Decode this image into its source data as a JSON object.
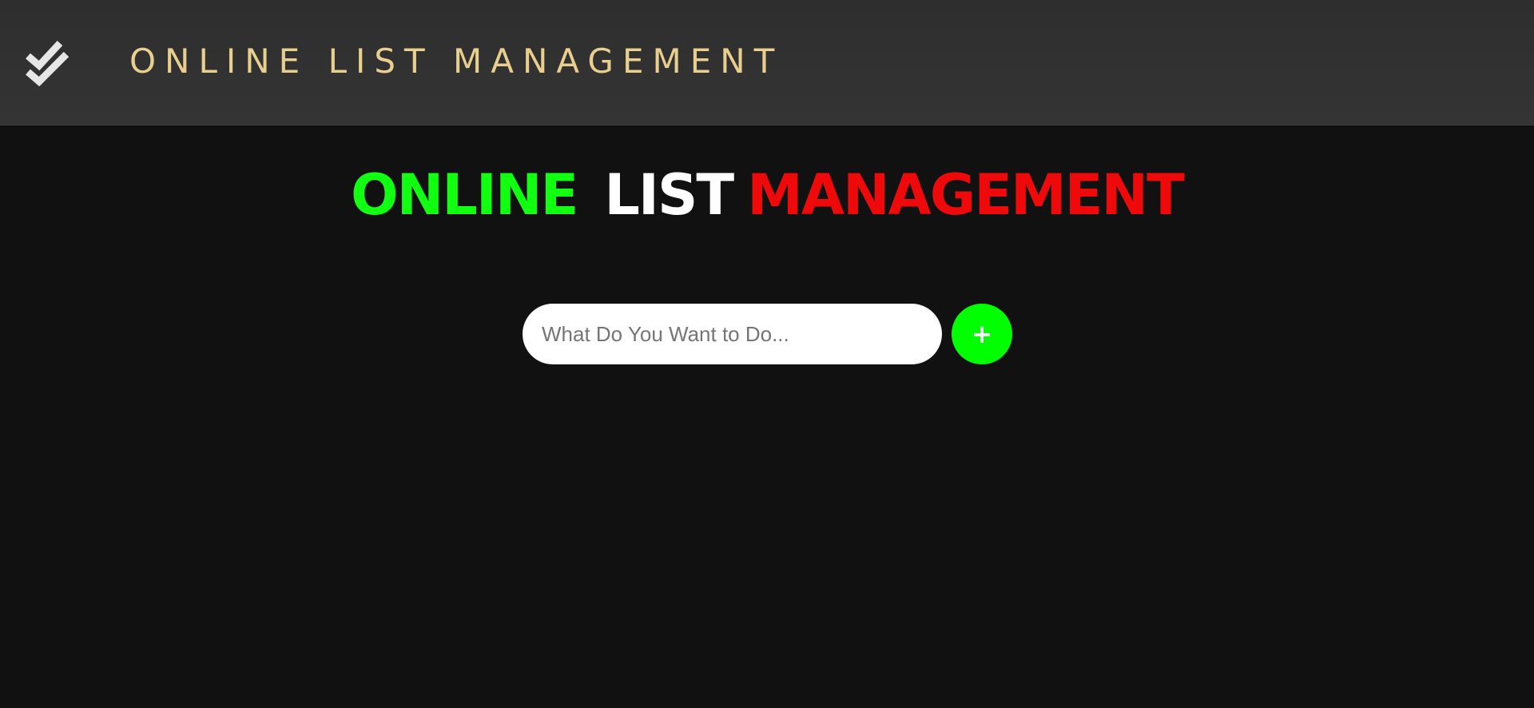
{
  "header": {
    "brand": "ONLINE LIST MANAGEMENT",
    "logo_icon": "double-check-icon"
  },
  "main": {
    "title_words": [
      "ONLINE",
      "LIST",
      "MANAGEMENT"
    ],
    "task_input": {
      "placeholder": "What Do You Want to Do...",
      "value": ""
    },
    "add_button_label": "+"
  },
  "colors": {
    "header_bg": "#333333",
    "page_bg": "#111111",
    "brand_text": "#e8cf8d",
    "title_word_1": "#11ff11",
    "title_word_2": "#ffffff",
    "title_word_3": "#ee0a0a",
    "add_button_bg": "#00ff00"
  }
}
